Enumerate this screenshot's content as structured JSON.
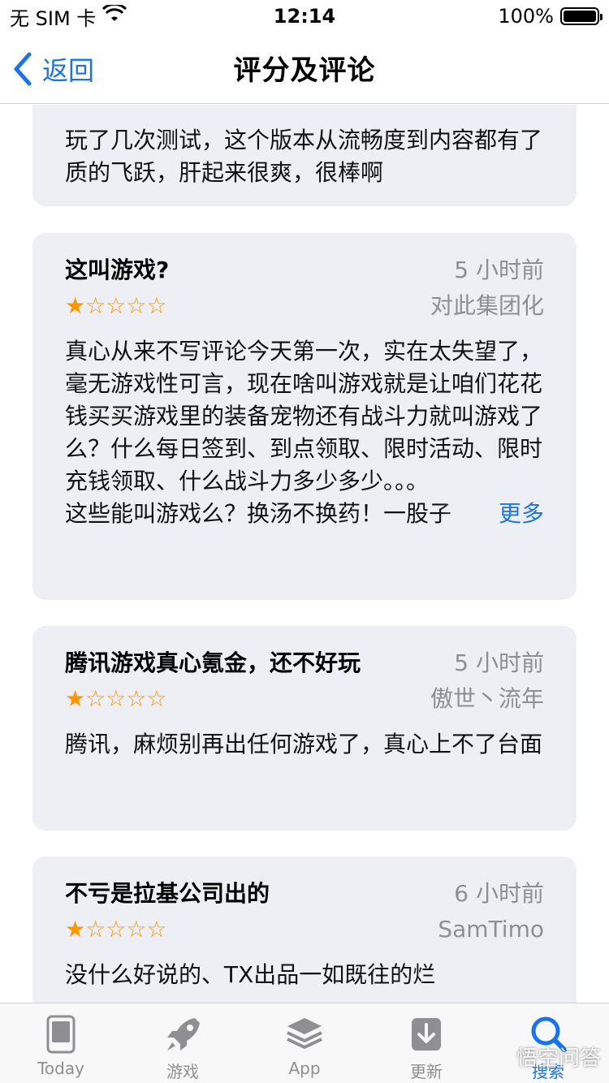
{
  "status_bar": {
    "carrier": "无 SIM 卡",
    "time": "12:14",
    "battery": "100%"
  },
  "nav": {
    "back_label": "返回",
    "title": "评分及评论"
  },
  "reviews": [
    {
      "body": "玩了几次测试，这个版本从流畅度到内容都有了质的飞跃，肝起来很爽，很棒啊"
    },
    {
      "title": "这叫游戏?",
      "time": "5 小时前",
      "author": "对此集团化",
      "rating": 1,
      "stars": "★☆☆☆☆",
      "body": "真心从来不写评论今天第一次，实在太失望了，毫无游戏性可言，现在啥叫游戏就是让咱们花花钱买买游戏里的装备宠物还有战斗力就叫游戏了么？什么每日签到、到点领取、限时活动、限时充钱领取、什么战斗力多少多少。。。",
      "body_last": "这些能叫游戏么？换汤不换药！一股子",
      "more_label": "更多"
    },
    {
      "title": "腾讯游戏真心氪金，还不好玩",
      "time": "5 小时前",
      "author": "傲世丶流年",
      "rating": 1,
      "stars": "★☆☆☆☆",
      "body": "腾讯，麻烦别再出任何游戏了，真心上不了台面"
    },
    {
      "title": "不亏是拉基公司出的",
      "time": "6 小时前",
      "author": "SamTimo",
      "rating": 1,
      "stars": "★☆☆☆☆",
      "body": "没什么好说的、TX出品一如既往的烂"
    }
  ],
  "tabs": [
    {
      "label": "Today",
      "icon": "today-icon"
    },
    {
      "label": "游戏",
      "icon": "rocket-icon"
    },
    {
      "label": "App",
      "icon": "layers-icon"
    },
    {
      "label": "更新",
      "icon": "download-icon"
    },
    {
      "label": "搜索",
      "icon": "search-icon"
    }
  ],
  "watermark": "悟空问答",
  "colors": {
    "accent": "#1a73e8",
    "star": "#ff9500",
    "card_bg": "#eeeff5",
    "muted": "#8e8e93"
  }
}
